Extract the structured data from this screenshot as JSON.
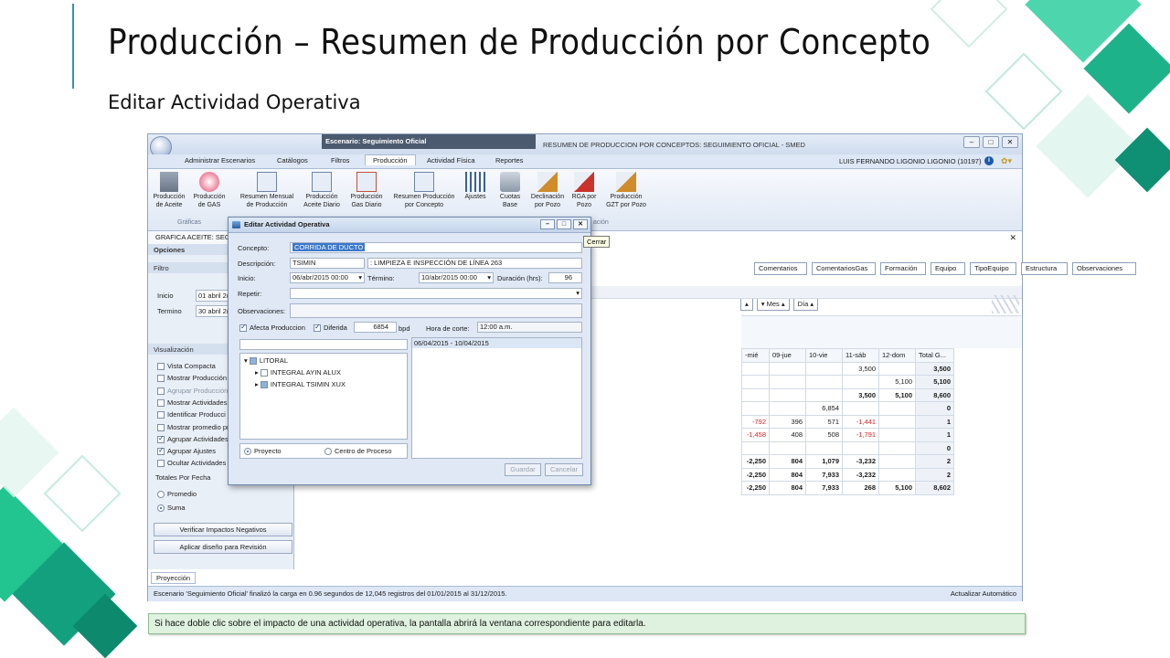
{
  "slide": {
    "title": "Producción – Resumen de Producción por Concepto",
    "subtitle": "Editar Actividad Operativa",
    "caption": "Si hace doble clic sobre el impacto de una actividad operativa, la pantalla abrirá la ventana correspondiente para editarla."
  },
  "app": {
    "scenario_title": "Escenario: Seguimiento Oficial",
    "window_title": "RESUMEN DE PRODUCCION POR CONCEPTOS: SEGUIMIENTO OFICIAL - SMED",
    "user": "LUIS FERNANDO LIGONIO LIGONIO (10197)",
    "tabs": [
      "Administrar Escenarios",
      "Catálogos",
      "Filtros",
      "Producción",
      "Actividad Física",
      "Reportes"
    ],
    "active_tab": "Producción",
    "ribbon": {
      "buttons": [
        "Producción de Aceite",
        "Producción de GAS",
        "Resumen Mensual de Producción",
        "Producción Aceite Diario",
        "Producción Gas Diario",
        "Resumen Producción por Concepto",
        "Ajustes",
        "Cuotas Base",
        "Declinación por Pozo",
        "RGA por Pozo",
        "Producción GZT por Pozo"
      ],
      "group_graficas": "Gráficas",
      "group_visible_tail": "ación"
    },
    "doc_tab": "GRAFICA ACEITE: SEG",
    "left_panel": {
      "options_header": "Opciones",
      "filter_header": "Filtro",
      "inicio_label": "Inicio",
      "inicio_value": "01 abril 2(",
      "termino_label": "Termino",
      "termino_value": "30 abril 2(",
      "viz_header": "Visualización",
      "items": [
        {
          "label": "Vista Compacta",
          "checked": false
        },
        {
          "label": "Mostrar Producción",
          "checked": false
        },
        {
          "label": "Agrupar Producción",
          "checked": false
        },
        {
          "label": "Mostrar Actividades",
          "checked": false
        },
        {
          "label": "Identificar Producci",
          "checked": false
        },
        {
          "label": "Mostrar promedio pr",
          "checked": false
        },
        {
          "label": "Agrupar Actividades",
          "checked": true
        },
        {
          "label": "Agrupar Ajustes",
          "checked": true
        },
        {
          "label": "Ocultar Actividades",
          "checked": false
        }
      ],
      "totals_header": "Totales Por Fecha",
      "promedio": "Promedio",
      "suma": "Suma",
      "btn_verificar": "Verificar Impactos Negativos",
      "btn_aplicar": "Aplicar diseño para Revisión",
      "bottom_tab": "Proyección"
    },
    "grid": {
      "column_buttons": [
        "Comentarios",
        "ComentariosGas",
        "Formación",
        "Equipo",
        "TipoEquipo",
        "Estructura",
        "Observaciones"
      ],
      "group_buttons": [
        "Mes",
        "Día"
      ],
      "headers": [
        "-mié",
        "09-jue",
        "10-vie",
        "11-sáb",
        "12-dom",
        "Total G..."
      ],
      "rows": [
        [
          "",
          "",
          "",
          "3,500",
          "",
          "3,500"
        ],
        [
          "",
          "",
          "",
          "",
          "5,100",
          "5,100"
        ],
        [
          "",
          "",
          "",
          "3,500",
          "5,100",
          "8,600"
        ],
        [
          "",
          "",
          "6,854",
          "",
          "",
          "0"
        ],
        [
          "-792",
          "396",
          "571",
          "-1,441",
          "",
          "1"
        ],
        [
          "-1,458",
          "408",
          "508",
          "-1,791",
          "",
          "1"
        ],
        [
          "",
          "",
          "",
          "",
          "",
          "0"
        ],
        [
          "-2,250",
          "804",
          "1,079",
          "-3,232",
          "",
          "2"
        ],
        [
          "-2,250",
          "804",
          "7,933",
          "-3,232",
          "",
          "2"
        ],
        [
          "-2,250",
          "804",
          "7,933",
          "268",
          "5,100",
          "8,602"
        ]
      ]
    },
    "status_text": "Escenario 'Seguimiento Oficial' finalizó la carga en 0.96 segundos de 12,045 registros del 01/01/2015 al 31/12/2015.",
    "status_right": "Actualizar Automático"
  },
  "dialog": {
    "title": "Editar Actividad Operativa",
    "tooltip": "Cerrar",
    "concepto_label": "Concepto:",
    "concepto_value": "CORRIDA DE DUCTO",
    "descripcion_label": "Descripción:",
    "descripcion_code": "TSIMIN",
    "descripcion_text": ": LIMPIEZA E INSPECCIÓN DE LÍNEA 263",
    "inicio_label": "Inicio:",
    "inicio_value": "06/abr/2015 00:00",
    "termino_label": "Término:",
    "termino_value": "10/abr/2015 00:00",
    "duracion_label": "Duración (hrs):",
    "duracion_value": "96",
    "repetir_label": "Repetir:",
    "observaciones_label": "Observaciones:",
    "afecta_label": "Afecta Produccion",
    "diferida_label": "Diferida",
    "diferida_value": "6854",
    "unit": "bpd",
    "hora_label": "Hora de corte:",
    "hora_value": "12:00 a.m.",
    "date_range": "06/04/2015 - 10/04/2015",
    "tree": [
      "LITORAL",
      "INTEGRAL AYIN ALUX",
      "INTEGRAL TSIMIN XUX"
    ],
    "radio_proyecto": "Proyecto",
    "radio_centro": "Centro de Proceso",
    "btn_guardar": "Guardar",
    "btn_cancelar": "Cancelar"
  }
}
